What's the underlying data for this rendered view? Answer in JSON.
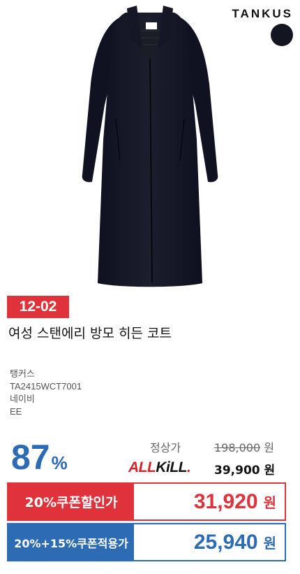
{
  "brand": {
    "logo_text": "TANKUS",
    "color_swatch": "#131520"
  },
  "date_badge": "12-02",
  "product": {
    "title": "여성 스탠에리 방모 히든 코트",
    "brand_name": "탱커스",
    "product_code": "TA2415WCT7001",
    "color": "네이비",
    "size": "EE"
  },
  "pricing": {
    "discount_rate": "87",
    "discount_unit": "%",
    "regular_label": "정상가",
    "regular_price": "198,000",
    "regular_currency": "원",
    "allkill_logo": {
      "part1": "ALL",
      "part2": "KiLL",
      "part3": "."
    },
    "sale_price": "39,900 원"
  },
  "coupons": [
    {
      "label": "20%쿠폰할인가",
      "price": "31,920",
      "currency": "원",
      "color": "#e0323b"
    },
    {
      "label": "20%+15%쿠폰적용가",
      "price": "25,940",
      "currency": "원",
      "color": "#2d6cb5"
    }
  ],
  "colors": {
    "red": "#e0323b",
    "blue": "#2d6cb5"
  }
}
